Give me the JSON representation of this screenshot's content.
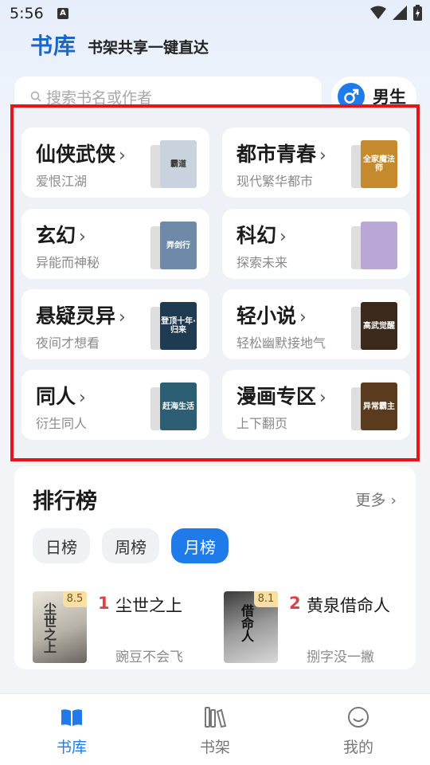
{
  "status_bar": {
    "time": "5:56",
    "notif_letter": "A"
  },
  "header": {
    "title": "书库",
    "subtitle": "书架共享一键直达"
  },
  "search": {
    "placeholder": "搜索书名或作者"
  },
  "gender": {
    "label": "男生",
    "icon": "male-icon"
  },
  "categories": [
    {
      "name": "仙侠武侠",
      "desc": "爱恨江湖",
      "cover_text": "霸道",
      "cover_color": "#c9d3de"
    },
    {
      "name": "都市青春",
      "desc": "现代繁华都市",
      "cover_text": "全家魔法师",
      "cover_color": "#c58a2e"
    },
    {
      "name": "玄幻",
      "desc": "异能而神秘",
      "cover_text": "弄剑行",
      "cover_color": "#6f8aa8"
    },
    {
      "name": "科幻",
      "desc": "探索未来",
      "cover_text": "",
      "cover_color": "#b9a7d6"
    },
    {
      "name": "悬疑灵异",
      "desc": "夜间才想看",
      "cover_text": "登顶十年·归来",
      "cover_color": "#1e3b52"
    },
    {
      "name": "轻小说",
      "desc": "轻松幽默接地气",
      "cover_text": "高武觉醒",
      "cover_color": "#3b2a1c"
    },
    {
      "name": "同人",
      "desc": "衍生同人",
      "cover_text": "赶海生活",
      "cover_color": "#2c5f73"
    },
    {
      "name": "漫画专区",
      "desc": "上下翻页",
      "cover_text": "异常霸主",
      "cover_color": "#5a3b1d"
    }
  ],
  "ranking": {
    "title": "排行榜",
    "more": "更多",
    "tabs": [
      {
        "label": "日榜",
        "active": false
      },
      {
        "label": "周榜",
        "active": false
      },
      {
        "label": "月榜",
        "active": true
      }
    ],
    "books": [
      {
        "rank": "1",
        "title": "尘世之上",
        "author": "豌豆不会飞",
        "score": "8.5",
        "cover_text": "尘世之上"
      },
      {
        "rank": "2",
        "title": "黄泉借命人",
        "author": "捌字没一撇",
        "score": "8.1",
        "cover_text": "借命人"
      }
    ]
  },
  "tabbar": [
    {
      "label": "书库",
      "icon": "book-open-icon",
      "active": true
    },
    {
      "label": "书架",
      "icon": "bookshelf-icon",
      "active": false
    },
    {
      "label": "我的",
      "icon": "smiley-icon",
      "active": false
    }
  ],
  "colors": {
    "accent": "#1f7bea",
    "highlight_border": "#e8141b",
    "rank_number": "#e04040"
  }
}
